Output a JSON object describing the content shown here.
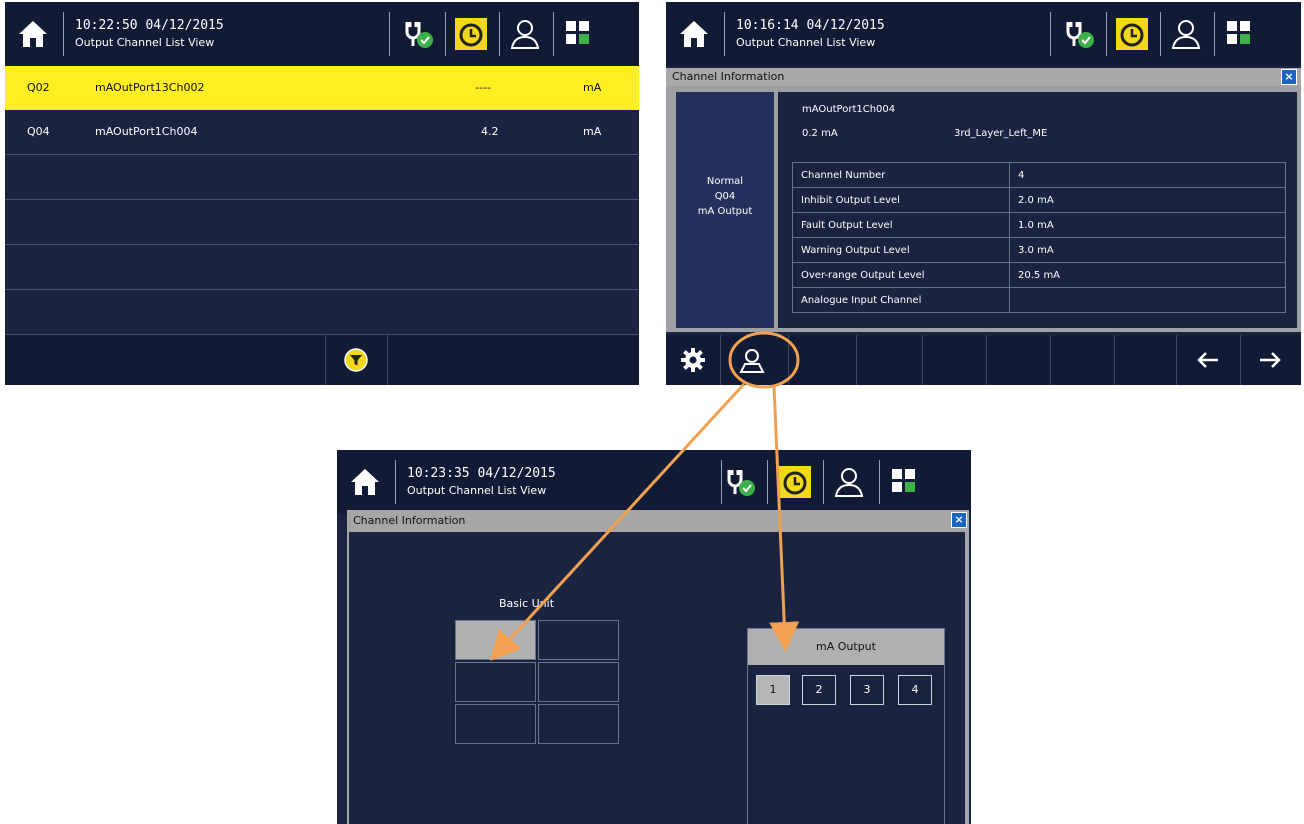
{
  "screens": {
    "list": {
      "time": "10:22:50 04/12/2015",
      "title": "Output Channel List View",
      "rows": [
        {
          "id": "Q02",
          "name": "mAOutPort13Ch002",
          "value": "----",
          "unit": "mA",
          "selected": true
        },
        {
          "id": "Q04",
          "name": "mAOutPort1Ch004",
          "value": "4.2",
          "unit": "mA",
          "selected": false
        }
      ]
    },
    "detail": {
      "time": "10:16:14  04/12/2015",
      "title": "Output Channel List View",
      "dialog_title": "Channel Information",
      "left_panel": {
        "status": "Normal",
        "id": "Q04",
        "type": "mA Output"
      },
      "channel_name": "mAOutPort1Ch004",
      "reading": "0.2 mA",
      "location": "3rd_Layer_Left_ME",
      "table": [
        {
          "label": "Channel Number",
          "value": "4"
        },
        {
          "label": "Inhibit Output Level",
          "value": "2.0  mA"
        },
        {
          "label": "Fault Output Level",
          "value": "1.0  mA"
        },
        {
          "label": "Warning Output Level",
          "value": "3.0  mA"
        },
        {
          "label": "Over-range Output Level",
          "value": "20.5  mA"
        },
        {
          "label": "Analogue Input Channel",
          "value": ""
        }
      ]
    },
    "location": {
      "time": "10:23:35 04/12/2015",
      "title": "Output Channel List View",
      "dialog_title": "Channel Information",
      "basic_unit_label": "Basic Unit",
      "module_label": "mA Output",
      "channels": [
        "1",
        "2",
        "3",
        "4"
      ]
    }
  },
  "icons": [
    "home-icon",
    "power-plug-ok-icon",
    "alarm-clock-icon",
    "user-icon",
    "grid-icon",
    "filter-icon",
    "gear-icon",
    "location-icon",
    "arrow-left-icon",
    "arrow-right-icon",
    "close-icon"
  ],
  "colors": {
    "selected_row": "#ffee22",
    "background": "#1a2440",
    "header": "#121b36",
    "callout": "#f0a050"
  }
}
